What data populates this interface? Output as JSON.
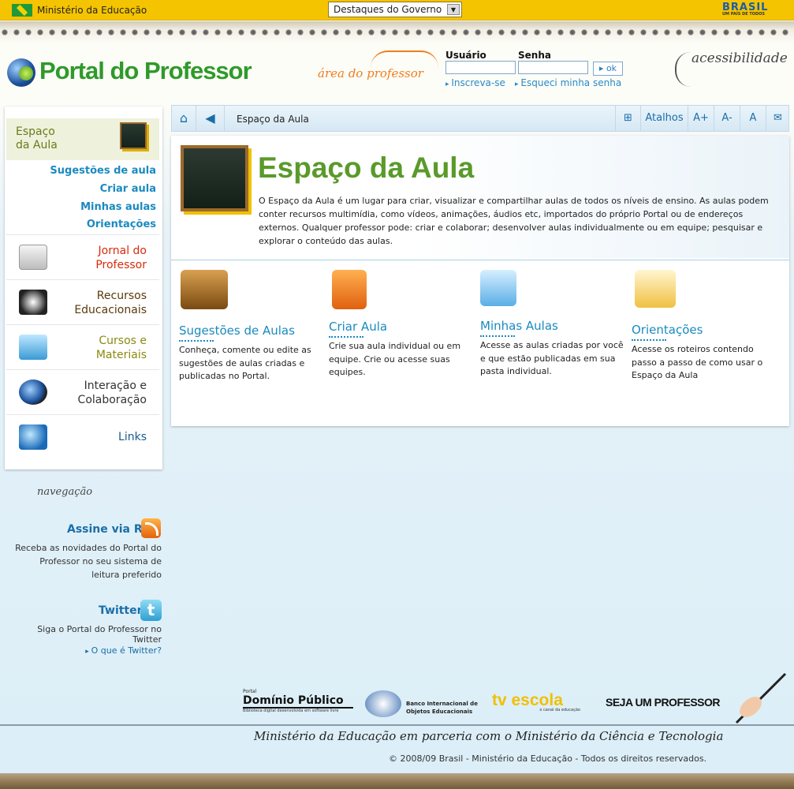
{
  "govbar": {
    "ministry": "Ministério da Educação",
    "destaques": "Destaques do Governo",
    "brasil": "BRASIL",
    "brasil_tagline": "UM PAÍS DE TODOS"
  },
  "header": {
    "logo_text": "Portal do Professor",
    "area_label": "área do professor",
    "usuario_label": "Usuário",
    "senha_label": "Senha",
    "ok_label": "ok",
    "inscreva": "Inscreva-se",
    "esqueci": "Esqueci minha senha",
    "acessibilidade": "acessibilidade"
  },
  "sidebar": {
    "active": {
      "line1": "Espaço",
      "line2": "da Aula"
    },
    "subitems": [
      "Sugestões de aula",
      "Criar aula",
      "Minhas aulas",
      "Orientações"
    ],
    "items": [
      {
        "line1": "Jornal do",
        "line2": "Professor"
      },
      {
        "line1": "Recursos",
        "line2": "Educacionais"
      },
      {
        "line1": "Cursos e",
        "line2": "Materiais"
      },
      {
        "line1": "Interação e",
        "line2": "Colaboração"
      },
      {
        "line1": "Links",
        "line2": ""
      }
    ],
    "colors": {
      "jornal": "#d92b0c",
      "recursos": "#5a3a0a",
      "cursos": "#8a8a10",
      "interacao": "#333333",
      "links": "#1a5a8a"
    },
    "navegacao": "navegação",
    "rss_title": "Assine via RSS",
    "rss_desc": "Receba as novidades do Portal do Professor no seu sistema de leitura preferido",
    "twitter_title": "Twitter",
    "twitter_desc": "Siga o Portal do Professor no Twitter",
    "twitter_link": "O que é Twitter?"
  },
  "crumbbar": {
    "home_icon": "home-icon",
    "back_icon": "back-arrow-icon",
    "current": "Espaço da Aula",
    "sitemap_icon": "sitemap-icon",
    "atalhos": "Atalhos",
    "font_increase": "A+",
    "font_decrease": "A-",
    "font_reset": "A",
    "mail_icon": "mail-icon"
  },
  "main": {
    "title": "Espaço da Aula",
    "intro": "O Espaço da Aula é um lugar para criar, visualizar e compartilhar aulas de todos os níveis de ensino. As aulas podem conter recursos multimídia, como vídeos, animações, áudios etc, importados do próprio Portal ou de endereços externos. Qualquer professor pode: criar e colaborar; desenvolver aulas individualmente ou em equipe; pesquisar e explorar o conteúdo das aulas.",
    "cards": [
      {
        "title": "Sugestões de Aulas",
        "desc": "Conheça, comente ou edite as sugestões de aulas criadas e publicadas no Portal.",
        "icon": "books-icon"
      },
      {
        "title": "Criar Aula",
        "desc": "Crie sua aula individual ou em equipe. Crie ou acesse suas equipes.",
        "icon": "create-book-icon"
      },
      {
        "title": "Minhas Aulas",
        "desc": "Acesse as aulas criadas por você e que estão publicadas em sua pasta individual.",
        "icon": "folder-icon"
      },
      {
        "title": "Orientações",
        "desc": "Acesse os roteiros contendo passo a passo de como usar o Espaço da Aula",
        "icon": "guide-icon"
      }
    ]
  },
  "footer": {
    "dominio_small": "Portal",
    "dominio": "Domínio Público",
    "dominio_sub": "Biblioteca digital desenvolvida em software livre",
    "biblioteca": "Banco Internacional de Objetos Educacionais",
    "tvescola": "tv escola",
    "tvescola_sub": "o canal da educação",
    "seja": "SEJA UM PROFESSOR",
    "parceria": "Ministério da Educação em parceria com o Ministério da Ciência e Tecnologia",
    "copyright": "© 2008/09 Brasil - Ministério da Educação - Todos os direitos reservados."
  }
}
